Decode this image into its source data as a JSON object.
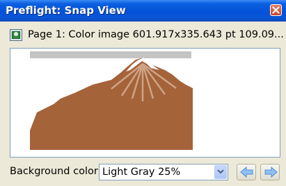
{
  "window": {
    "title": "Preflight: Snap View",
    "close_icon": "close-icon"
  },
  "info": {
    "icon": "color-image-icon",
    "text": "Page 1: Color image 601.917x335.643 pt 109.09..."
  },
  "preview": {
    "description_icon": "mountain-image",
    "colors": {
      "mountain": "#a5633a",
      "snow": "#ffffff",
      "top_band": "#c4c4c4"
    }
  },
  "bottom": {
    "background_label": "Background color:",
    "background_value": "Light Gray 25%",
    "dropdown_icon": "chevron-down-icon",
    "prev_icon": "arrow-left-icon",
    "next_icon": "arrow-right-icon"
  },
  "colors": {
    "title_bar": "#0552d8",
    "window_bg": "#ece9d8",
    "nav_arrow": "#6aa6e8"
  }
}
